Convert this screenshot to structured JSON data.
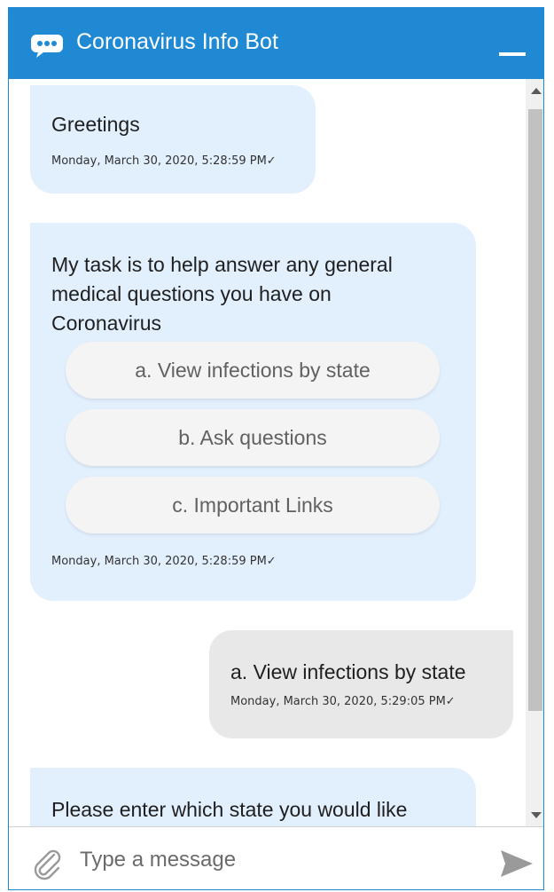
{
  "header": {
    "title": "Coronavirus Info Bot"
  },
  "messages": [
    {
      "sender": "bot",
      "text": "Greetings",
      "timestamp": "Monday, March 30, 2020, 5:28:59 PM✓"
    },
    {
      "sender": "bot",
      "text_lines": [
        "My task is to help answer any general",
        "medical questions you have on",
        "Coronavirus"
      ],
      "options": [
        "a. View infections by state",
        "b. Ask questions",
        "c. Important Links"
      ],
      "timestamp": "Monday, March 30, 2020, 5:28:59 PM✓"
    },
    {
      "sender": "user",
      "text": "a. View infections by state",
      "timestamp": "Monday, March 30, 2020, 5:29:05 PM✓"
    },
    {
      "sender": "bot",
      "text": "Please enter which state you would like"
    }
  ],
  "composer": {
    "placeholder": "Type a message"
  },
  "icons": {
    "header": "chat-bubble-icon",
    "attach": "paperclip-icon",
    "send": "send-icon"
  },
  "colors": {
    "header_bg": "#1f8ad3",
    "bot_bubble": "#e2effd",
    "user_bubble": "#e8e8e8",
    "option_bg": "#f4f4f4"
  }
}
